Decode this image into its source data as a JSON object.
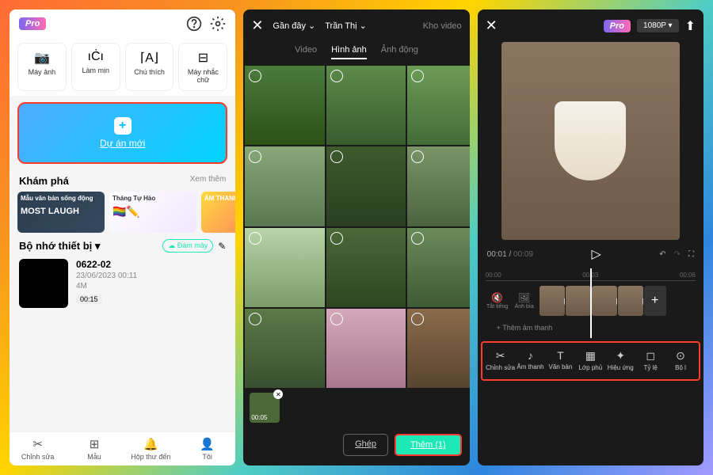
{
  "p1": {
    "pro": "Pro",
    "tools": [
      {
        "icon": "camera",
        "label": "Máy ảnh"
      },
      {
        "icon": "beautify",
        "label": "Làm mịn"
      },
      {
        "icon": "caption",
        "label": "Chú thích"
      },
      {
        "icon": "teleprompter",
        "label": "Máy nhắc chữ"
      }
    ],
    "newProject": "Dự án mới",
    "explore": {
      "title": "Khám phá",
      "more": "Xem thêm"
    },
    "cards": [
      {
        "label": "Mẫu văn bản sống động",
        "sub": "MOST LAUGH"
      },
      {
        "label": "Tháng Tự Hào",
        "sub": ""
      },
      {
        "label": "ÂM THANH",
        "sub": ""
      }
    ],
    "storage": {
      "title": "Bộ nhớ thiết bị",
      "cloud": "☁ Đám mây"
    },
    "project": {
      "name": "0622-02",
      "date": "23/06/2023 00:11",
      "size": "4M",
      "duration": "00:15"
    },
    "tabs": [
      {
        "icon": "✂",
        "label": "Chỉnh sửa"
      },
      {
        "icon": "⊞",
        "label": "Mẫu"
      },
      {
        "icon": "🔔",
        "label": "Hộp thư đến"
      },
      {
        "icon": "👤",
        "label": "Tôi"
      }
    ]
  },
  "p2": {
    "recent": "Gần đây",
    "album": "Trần Thị",
    "cloud": "Kho video",
    "tabs": {
      "video": "Video",
      "image": "Hình ảnh",
      "anim": "Ảnh động"
    },
    "selectedDur": "00:05",
    "btnMerge": "Ghép",
    "btnAdd": "Thêm (1)"
  },
  "p3": {
    "pro": "Pro",
    "resolution": "1080P",
    "time": {
      "current": "00:01",
      "total": "00:09"
    },
    "ruler": {
      "start": "00:00",
      "mid": "00:03",
      "end": "00:06"
    },
    "trackBtns": {
      "mute": "Tắt tiếng",
      "cover": "Ảnh bìa"
    },
    "audioAdd": "+ Thêm âm thanh",
    "tools": [
      {
        "icon": "✂",
        "label": "Chỉnh sửa"
      },
      {
        "icon": "♪",
        "label": "Âm thanh"
      },
      {
        "icon": "T",
        "label": "Văn bản"
      },
      {
        "icon": "▦",
        "label": "Lớp phủ"
      },
      {
        "icon": "✦",
        "label": "Hiệu ứng"
      },
      {
        "icon": "◻",
        "label": "Tỷ lệ"
      },
      {
        "icon": "⊙",
        "label": "Bộ l"
      }
    ]
  }
}
